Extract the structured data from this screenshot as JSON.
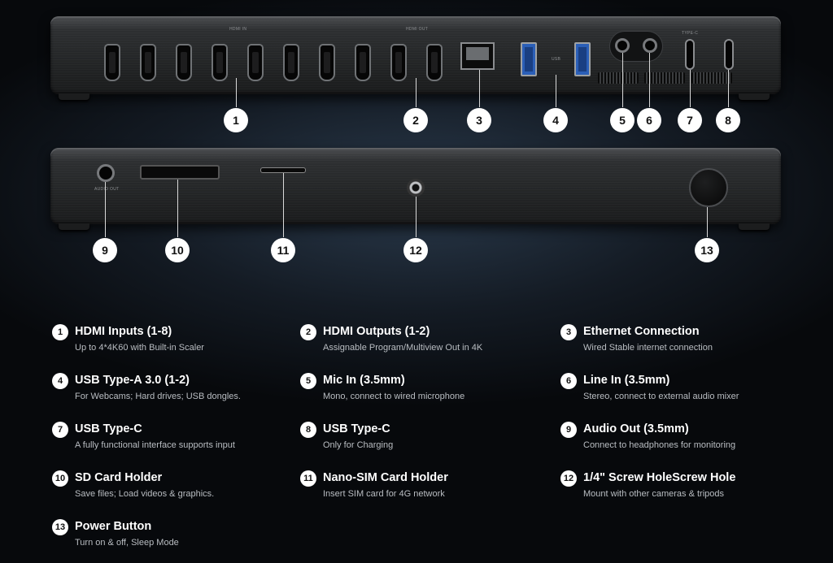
{
  "colors": {
    "accent_usb": "#2b5fb8",
    "callout_bg": "#ffffff",
    "text": "#ffffff",
    "subtext": "#b9bdc2"
  },
  "device": {
    "port_labels": {
      "hdmi_in": "HDMI IN",
      "hdmi_out": "HDMI OUT",
      "usb": "USB",
      "type_c": "TYPE-C",
      "audio_out": "AUDIO OUT"
    }
  },
  "callouts": [
    "1",
    "2",
    "3",
    "4",
    "5",
    "6",
    "7",
    "8",
    "9",
    "10",
    "11",
    "12",
    "13"
  ],
  "features": [
    {
      "num": "1",
      "title": "HDMI Inputs (1-8)",
      "desc": "Up to 4*4K60 with Built-in Scaler"
    },
    {
      "num": "2",
      "title": "HDMI Outputs (1-2)",
      "desc": "Assignable Program/Multiview Out in 4K"
    },
    {
      "num": "3",
      "title": "Ethernet Connection",
      "desc": "Wired Stable internet connection"
    },
    {
      "num": "4",
      "title": "USB Type-A 3.0 (1-2)",
      "desc": "For Webcams; Hard drives; USB dongles."
    },
    {
      "num": "5",
      "title": "Mic In (3.5mm)",
      "desc": "Mono, connect to wired microphone"
    },
    {
      "num": "6",
      "title": "Line In (3.5mm)",
      "desc": "Stereo, connect to external audio mixer"
    },
    {
      "num": "7",
      "title": "USB Type-C",
      "desc": "A fully functional interface supports input"
    },
    {
      "num": "8",
      "title": "USB Type-C",
      "desc": "Only for Charging"
    },
    {
      "num": "9",
      "title": "Audio Out (3.5mm)",
      "desc": "Connect to headphones for monitoring"
    },
    {
      "num": "10",
      "title": "SD Card Holder",
      "desc": "Save files; Load videos & graphics."
    },
    {
      "num": "11",
      "title": "Nano-SIM Card Holder",
      "desc": "Insert SIM card for 4G network"
    },
    {
      "num": "12",
      "title": "1/4\" Screw HoleScrew Hole",
      "desc": "Mount with other cameras & tripods"
    },
    {
      "num": "13",
      "title": "Power Button",
      "desc": "Turn on & off,  Sleep Mode"
    }
  ]
}
